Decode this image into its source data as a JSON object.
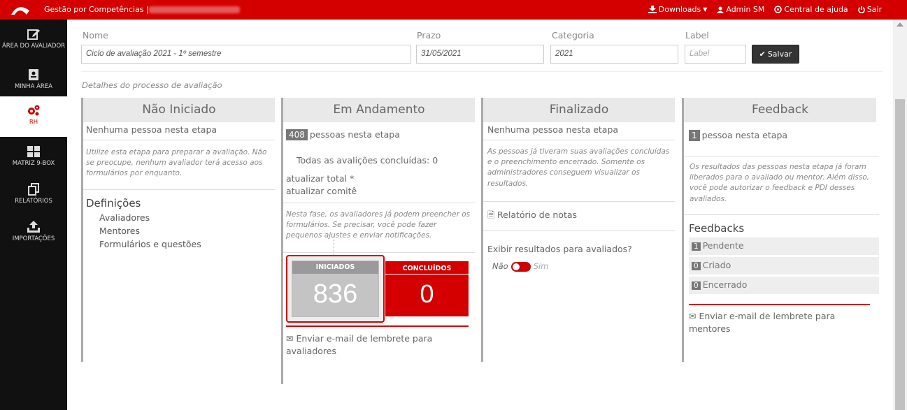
{
  "topbar": {
    "app_title": "Gestão por Competências |",
    "downloads": "Downloads",
    "user": "Admin SM",
    "help": "Central de ajuda",
    "logout": "Sair"
  },
  "sidebar": {
    "items": [
      {
        "label": "ÁREA DO AVALIADOR",
        "icon": "edit-icon"
      },
      {
        "label": "MINHA ÁREA",
        "icon": "contact-card-icon"
      },
      {
        "label": "RH",
        "icon": "gears-icon"
      },
      {
        "label": "MATRIZ 9-BOX",
        "icon": "grid-icon"
      },
      {
        "label": "RELATÓRIOS",
        "icon": "copy-icon"
      },
      {
        "label": "IMPORTAÇÕES",
        "icon": "upload-icon"
      }
    ]
  },
  "form": {
    "name_label": "Nome",
    "name_value": "Ciclo de avaliação 2021 - 1º semestre",
    "deadline_label": "Prazo",
    "deadline_value": "31/05/2021",
    "category_label": "Categoria",
    "category_value": "2021",
    "label_label": "Label",
    "label_placeholder": "Label",
    "save": "Salvar"
  },
  "details_link": "Detalhes do processo de avaliação",
  "stages": {
    "not_started": {
      "title": "Não Iniciado",
      "count_text": "Nenhuma pessoa nesta etapa",
      "note": "Utilize esta etapa para preparar a avaliação. Não se preocupe, nenhum avaliador terá acesso aos formulários por enquanto.",
      "definitions_title": "Definições",
      "definitions": [
        "Avaliadores",
        "Mentores",
        "Formulários e questões"
      ]
    },
    "in_progress": {
      "title": "Em Andamento",
      "count": "408",
      "count_text": "pessoas nesta etapa",
      "all_done": "Todas as avalições concluídas: 0",
      "update_total": "atualizar total *",
      "update_committee": "atualizar comitê",
      "note": "Nesta fase, os avaliadores já podem preencher os formulários. Se precisar, você pode fazer pequenos ajustes e enviar notificações.",
      "started_label": "INICIADOS",
      "started_value": "836",
      "done_label": "CONCLUÍDOS",
      "done_value": "0",
      "email_reminder": "Enviar e-mail de lembrete para avaliadores"
    },
    "finished": {
      "title": "Finalizado",
      "count_text": "Nenhuma pessoa nesta etapa",
      "note": "As pessoas já tiveram suas avaliações concluídas e o preenchimento encerrado. Somente os administradores conseguem visualizar os resultados.",
      "report": "Relatório de notas",
      "show_results": "Exibir resultados para avaliados?",
      "no": "Não",
      "yes": "Sim"
    },
    "feedback": {
      "title": "Feedback",
      "count": "1",
      "count_text": "pessoa nesta etapa",
      "note": "Os resultados das pessoas nesta etapa já foram liberados para o avaliado ou mentor. Além disso, você pode autorizar o feedback e PDI desses avaliados.",
      "feedbacks_title": "Feedbacks",
      "rows": [
        {
          "count": "1",
          "label": "Pendente"
        },
        {
          "count": "0",
          "label": "Criado"
        },
        {
          "count": "0",
          "label": "Encerrado"
        }
      ],
      "email_reminder": "Enviar e-mail de lembrete para mentores"
    }
  },
  "colors": {
    "brand_red": "#d40000",
    "started_grey": "#c4c4c4"
  }
}
